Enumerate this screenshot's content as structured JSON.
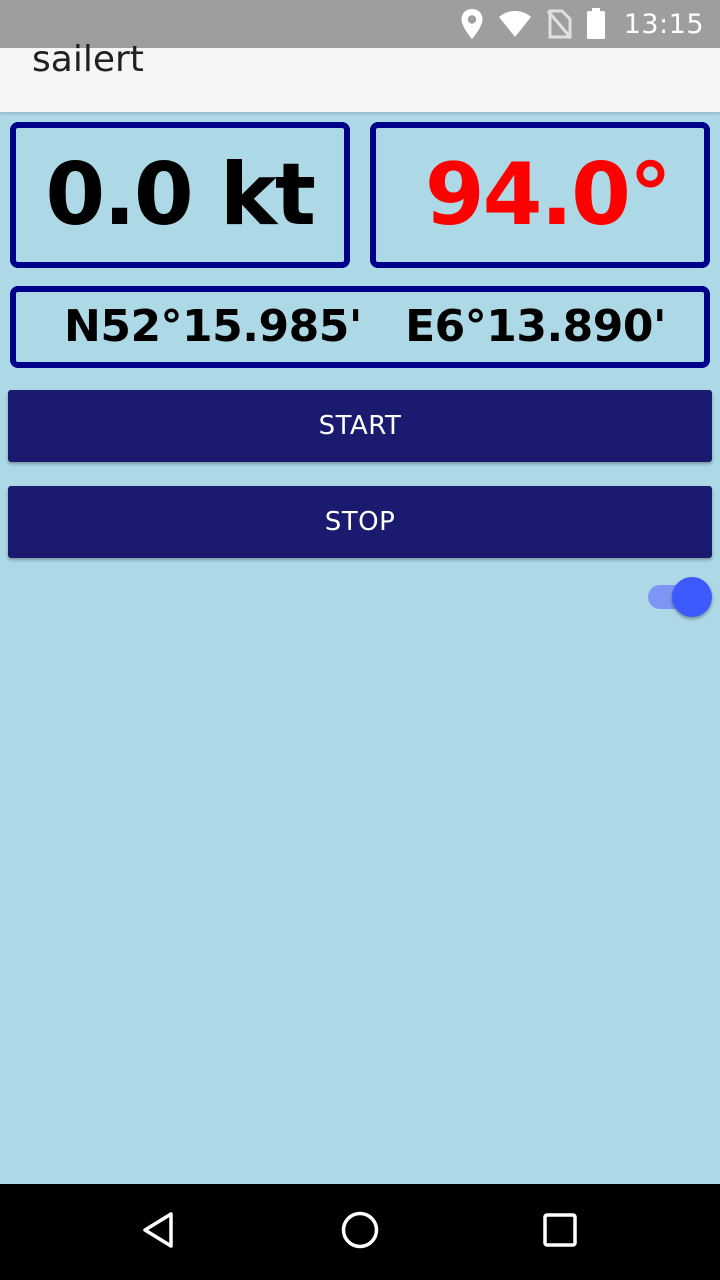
{
  "status_bar": {
    "time": "13:15",
    "icons": [
      "location-icon",
      "wifi-icon",
      "no-sim-icon",
      "battery-icon"
    ]
  },
  "app_bar": {
    "title": "sailert"
  },
  "readouts": {
    "speed": "0.0 kt",
    "heading": "94.0°",
    "latitude": "N52°15.985'",
    "longitude": "E6°13.890'"
  },
  "buttons": {
    "start_label": "START",
    "stop_label": "STOP"
  },
  "toggle": {
    "state": "on"
  },
  "colors": {
    "background": "#add8e6",
    "box_border": "#00008b",
    "heading_text": "#ff0000",
    "button_bg": "#1a1a6e",
    "toggle_thumb": "#3d5afe",
    "toggle_track": "#7d96f5"
  },
  "nav_bar": {
    "icons": [
      "back-icon",
      "home-icon",
      "recents-icon"
    ]
  }
}
